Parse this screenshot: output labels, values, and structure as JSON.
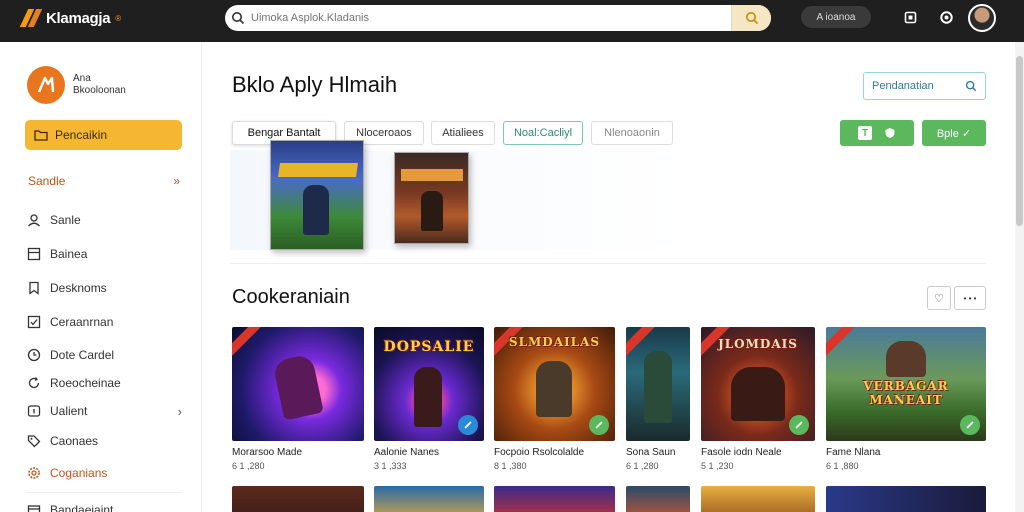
{
  "app": {
    "logo_text": "Klamagja",
    "logo_sup": "®"
  },
  "topbar": {
    "search_placeholder": "Uimoka Asplok.Kladanis",
    "account_button_label": "A ioanoa",
    "icons": [
      "search-icon",
      "user-icon",
      "square-icon",
      "settings-icon",
      "avatar"
    ]
  },
  "sidebar": {
    "profile": {
      "line1": "Ana",
      "line2": "Bkooloonan"
    },
    "primary_item": {
      "label": "Pencaikin",
      "icon": "folder-icon"
    },
    "section": {
      "label": "Sandle",
      "chevron": "»"
    },
    "items": [
      {
        "label": "Sanle",
        "icon": "user-icon"
      },
      {
        "label": "Bainea",
        "icon": "list-icon"
      },
      {
        "label": "Desknoms",
        "icon": "bookmark-icon"
      },
      {
        "label": "Ceraanrnan",
        "icon": "check-square-icon"
      },
      {
        "label": "Dote Cardel",
        "icon": "clock-icon"
      },
      {
        "label": "Roeocheinae",
        "icon": "refresh-icon"
      },
      {
        "label": "Ualient",
        "icon": "info-icon",
        "chevron": "›"
      },
      {
        "label": "Caonaes",
        "icon": "tag-icon"
      },
      {
        "label": "Coganians",
        "icon": "gear-icon",
        "accent": true
      },
      {
        "label": "Bandaeiaint",
        "icon": "box-icon"
      }
    ]
  },
  "main": {
    "title": "Bklo Aply Hlmaih",
    "search_label": "Pendanatian",
    "tabs": [
      {
        "label": "Bengar Bantalt",
        "style": "active"
      },
      {
        "label": "Nloceroaos",
        "style": "normal"
      },
      {
        "label": "Atialiees",
        "style": "normal"
      },
      {
        "label": "Noal:Cacliyl",
        "style": "teal"
      },
      {
        "label": "Nlenoaonin",
        "style": "muted"
      }
    ],
    "tools": {
      "button1_text": "T",
      "apply_label": "Bple ✓"
    },
    "section_title": "Cookeraniain",
    "section_controls": {
      "heart": "♡",
      "more": "• • •"
    }
  },
  "cards": [
    {
      "name": "Morarsoo Made",
      "price": "6 1 ,280",
      "art_text": ""
    },
    {
      "name": "Aalonie Nanes",
      "price": "3 1 ,333",
      "art_text": "DOPSALIE"
    },
    {
      "name": "Focpoio Rsolcolalde",
      "price": "8 1 ,380",
      "art_text": "SLMDAILAS"
    },
    {
      "name": "Sona Saun",
      "price": "6 1 ,280",
      "art_text": ""
    },
    {
      "name": "Fasole iodn Neale",
      "price": "5 1 ,230",
      "art_text": "JLOMDAIS"
    },
    {
      "name": "Fame Nlana",
      "price": "6 1 ,880",
      "art_text": "VERBAGAR MANEAIT"
    }
  ],
  "colors": {
    "topbar": "#1f1f1f",
    "accent_orange": "#f5b731",
    "accent_red": "#c0541d",
    "green": "#5cb85c",
    "teal": "#2a8a73"
  }
}
